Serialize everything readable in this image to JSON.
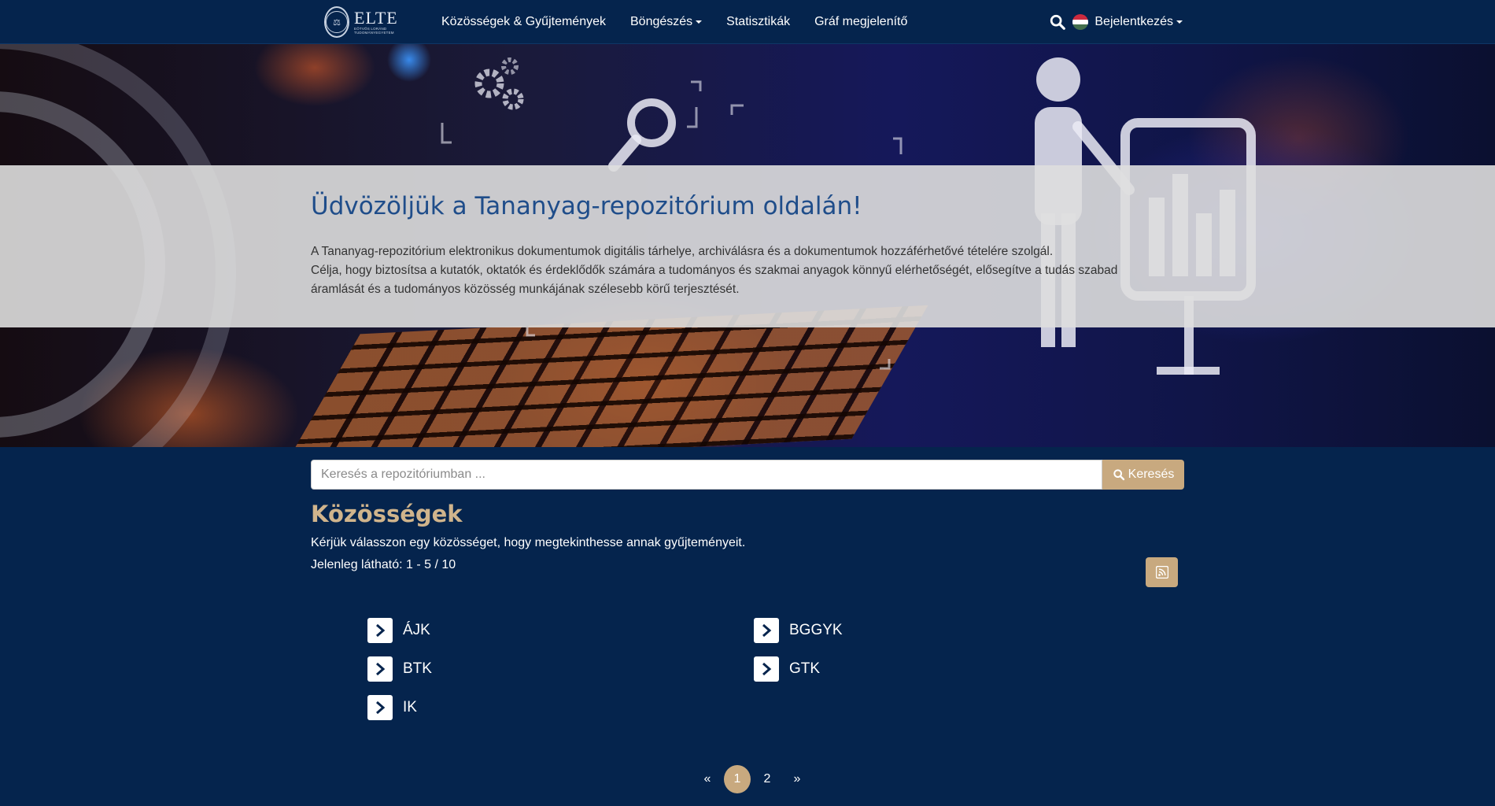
{
  "logo": {
    "title": "ELTE",
    "subtitle": "EÖTVÖS LORÁND TUDOMÁNYEGYETEM"
  },
  "nav": {
    "items": [
      {
        "label": "Közösségek & Gyűjtemények",
        "dropdown": false
      },
      {
        "label": "Böngészés",
        "dropdown": true
      },
      {
        "label": "Statisztikák",
        "dropdown": false
      },
      {
        "label": "Gráf megjelenítő",
        "dropdown": false
      }
    ],
    "login_label": "Bejelentkezés",
    "search_icon": "search-icon",
    "language_flag": "hungarian-flag-icon"
  },
  "hero": {
    "title": "Üdvözöljük a Tananyag-repozitórium oldalán!",
    "line1": "A Tananyag-repozitórium elektronikus dokumentumok digitális tárhelye, archiválásra és a dokumentumok hozzáférhetővé tételére szolgál.",
    "line2": "Célja, hogy biztosítsa a kutatók, oktatók és érdeklődők számára a tudományos és szakmai anyagok könnyű elérhetőségét, elősegítve a tudás szabad áramlását és a tudományos közösség munkájának szélesebb körű terjesztését."
  },
  "search": {
    "placeholder": "Keresés a repozitóriumban ...",
    "value": "",
    "button_label": "Keresés"
  },
  "communities": {
    "title": "Közösségek",
    "description": "Kérjük válasszon egy közösséget, hogy megtekinthesse annak gyűjteményeit.",
    "showing": "Jelenleg látható: 1 - 5 / 10",
    "items": [
      {
        "label": "ÁJK"
      },
      {
        "label": "BGGYK"
      },
      {
        "label": "BTK"
      },
      {
        "label": "GTK"
      },
      {
        "label": "IK"
      }
    ]
  },
  "pagination": {
    "prev": "«",
    "pages": [
      "1",
      "2"
    ],
    "current": "1",
    "next": "»"
  },
  "colors": {
    "background": "#05244d",
    "accent": "#c8a97f",
    "title_gold": "#d0b48c",
    "hero_title": "#1f4d8a"
  }
}
